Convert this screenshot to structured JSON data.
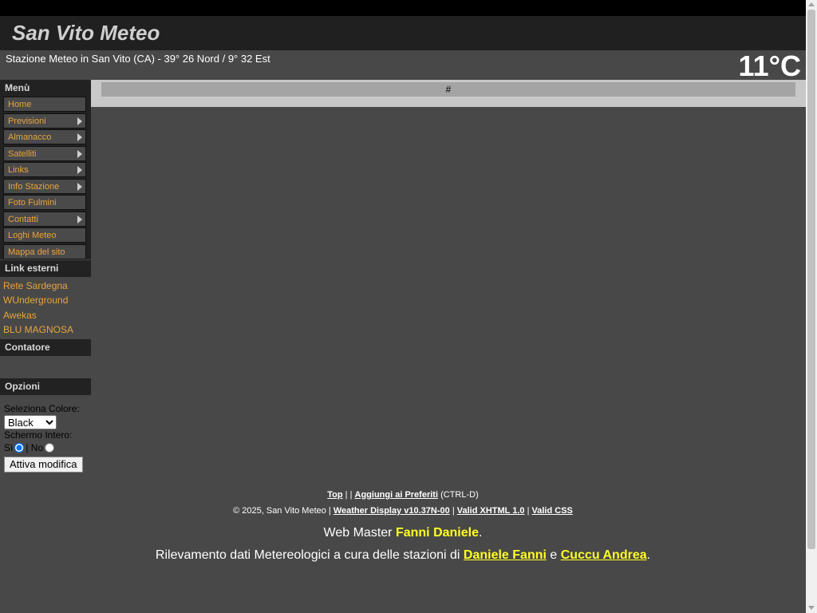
{
  "header": {
    "site_title": "San Vito Meteo",
    "station_info": "Stazione Meteo in San Vito (CA) - 39° 26 Nord / 9° 32 Est",
    "temperature": "11°C"
  },
  "sidebar": {
    "menu_title": "Menù",
    "menu_items": [
      {
        "label": "Home"
      },
      {
        "label": "Previsioni"
      },
      {
        "label": "Almanacco"
      },
      {
        "label": "Satelliti"
      },
      {
        "label": "Links"
      },
      {
        "label": "Info Stazione"
      },
      {
        "label": "Foto Fulmini"
      },
      {
        "label": "Contatti"
      },
      {
        "label": "Loghi Meteo"
      },
      {
        "label": "Mappa del sito"
      }
    ],
    "external_title": "Link esterni",
    "external_links": [
      {
        "label": "Rete Sardegna"
      },
      {
        "label": "WUnderground"
      },
      {
        "label": "Awekas"
      },
      {
        "label": "BLU MAGNOSA"
      }
    ],
    "counter_title": "Contatore",
    "options_title": "Opzioni",
    "options": {
      "color_label": "Seleziona Colore:",
      "color_value": "Black",
      "fullscreen_label": "Schermo Intero:",
      "yes_label": "Sì",
      "no_label": "| No",
      "apply_label": "Attiva modifica"
    }
  },
  "content": {
    "hash_text": "#"
  },
  "footer": {
    "top": "Top",
    "sep1": " | | ",
    "favorites": "Aggiungi ai Preferiti",
    "ctrl_d": " (CTRL-D)",
    "copyright": "© 2025, San Vito Meteo | ",
    "weather_display": "Weather Display v10.37N-00",
    "sep2": " | ",
    "valid_xhtml": "Valid XHTML 1.0",
    "sep3": " | ",
    "valid_css": "Valid CSS",
    "webmaster_prefix": "Web Master ",
    "webmaster_name": "Fanni Daniele",
    "period": ".",
    "rilevamento": "Rilevamento dati Metereologici a cura delle stazioni di ",
    "station1": "Daniele Fanni",
    "and": " e ",
    "station2": "Cuccu Andrea",
    "period2": "."
  },
  "colors": {
    "background": "#484848",
    "accent_orange": "#e8a43c",
    "highlight_yellow": "#ffff22"
  }
}
